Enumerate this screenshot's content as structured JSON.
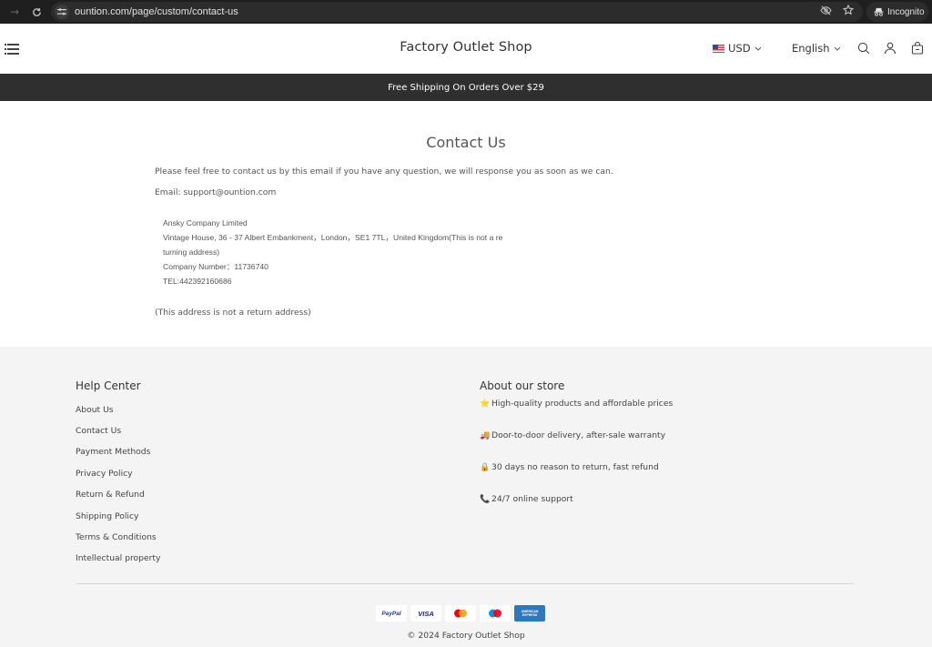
{
  "browser": {
    "url": "ountion.com/page/custom/contact-us",
    "incognito_label": "Incognito"
  },
  "header": {
    "shop_title": "Factory Outlet Shop",
    "currency": "USD",
    "language": "English"
  },
  "announcement": "Free Shipping On Orders Over $29",
  "main": {
    "title": "Contact Us",
    "intro": "Please feel free to contact us by this email if you have any question, we will response you as soon as we can.",
    "email": "Email: support@ountion.com",
    "address_lines": [
      "Ansky Company Limited",
      "Vintage House, 36 - 37 Albert Embankment，London，SE1 7TL，United Kingdom(This is not a re",
      "turning address)",
      "Company Number：11736740",
      "TEL:442392160686"
    ],
    "note": "(This address is not a return address)"
  },
  "footer": {
    "help_center": {
      "title": "Help Center",
      "links": [
        "About Us",
        "Contact Us",
        "Payment Methods",
        "Privacy Policy",
        "Return & Refund",
        "Shipping Policy",
        "Terms & Conditions",
        "Intellectual property"
      ]
    },
    "about_store": {
      "title": "About our store",
      "items": [
        {
          "icon": "star-icon",
          "glyph": "⭐",
          "text": "High-quality products and affordable prices"
        },
        {
          "icon": "delivery-icon",
          "glyph": "🚚",
          "text": "Door-to-door delivery, after-sale warranty"
        },
        {
          "icon": "lock-icon",
          "glyph": "🔒",
          "text": "30 days no reason to return, fast refund"
        },
        {
          "icon": "phone-icon",
          "glyph": "📞",
          "text": "24/7 online support"
        }
      ]
    },
    "payments": [
      {
        "name": "PayPal",
        "label": "PayPal",
        "color": "#253b80"
      },
      {
        "name": "Visa",
        "label": "VISA",
        "color": "#1a1f71"
      },
      {
        "name": "Mastercard",
        "label": "",
        "color": "#eb001b"
      },
      {
        "name": "Maestro",
        "label": "",
        "color": "#0099df"
      },
      {
        "name": "American Express",
        "label": "AMERICAN EXPRESS",
        "color": "#2e77bc"
      }
    ],
    "copyright": "© 2024 Factory Outlet Shop"
  }
}
